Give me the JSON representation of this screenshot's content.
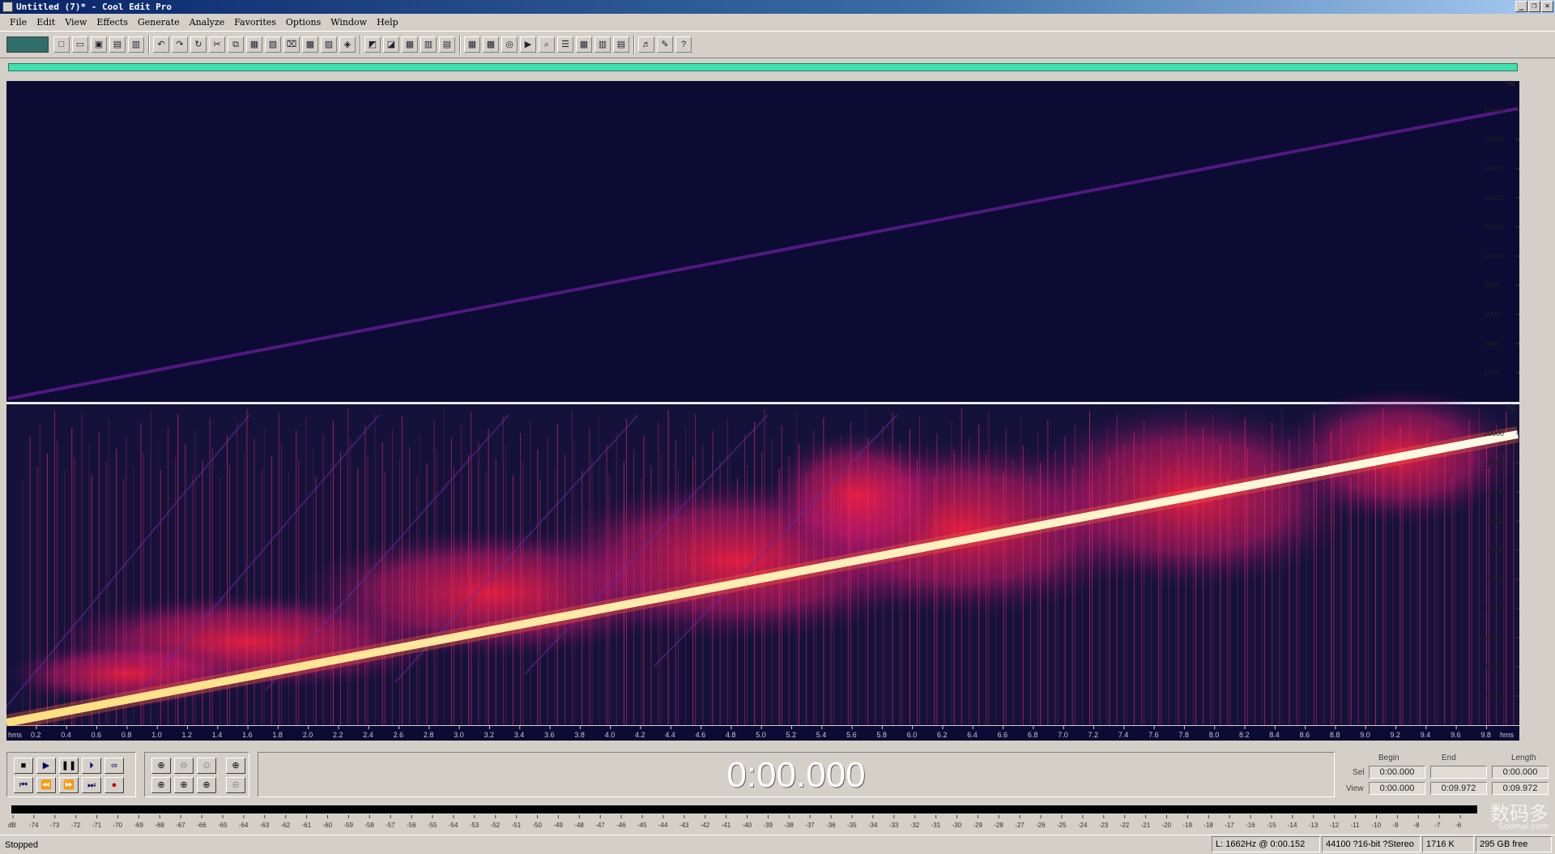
{
  "window": {
    "title": "Untitled (7)* - Cool Edit Pro",
    "controls": [
      "_",
      "❐",
      "✕"
    ]
  },
  "menu": [
    "File",
    "Edit",
    "View",
    "Effects",
    "Generate",
    "Analyze",
    "Favorites",
    "Options",
    "Window",
    "Help"
  ],
  "freq_axis": {
    "unit": "Hz",
    "ticks": [
      "20000",
      "18000",
      "16000",
      "14000",
      "12000",
      "10000",
      "8000",
      "6000",
      "4000",
      "2000"
    ]
  },
  "time_axis": {
    "start_label": "hms",
    "end_label": "hms",
    "ticks": [
      "0.2",
      "0.4",
      "0.6",
      "0.8",
      "1.0",
      "1.2",
      "1.4",
      "1.6",
      "1.8",
      "2.0",
      "2.2",
      "2.4",
      "2.6",
      "2.8",
      "3.0",
      "3.2",
      "3.4",
      "3.6",
      "3.8",
      "4.0",
      "4.2",
      "4.4",
      "4.6",
      "4.8",
      "5.0",
      "5.2",
      "5.4",
      "5.6",
      "5.8",
      "6.0",
      "6.2",
      "6.4",
      "6.6",
      "6.8",
      "7.0",
      "7.2",
      "7.4",
      "7.6",
      "7.8",
      "8.0",
      "8.2",
      "8.4",
      "8.6",
      "8.8",
      "9.0",
      "9.2",
      "9.4",
      "9.6",
      "9.8"
    ]
  },
  "transport": {
    "time": "0:00.000"
  },
  "selection": {
    "headers": {
      "begin": "Begin",
      "end": "End",
      "length": "Length"
    },
    "sel_label": "Sel",
    "view_label": "View",
    "sel_begin": "0:00.000",
    "sel_end": "",
    "sel_length": "0:00.000",
    "view_begin": "0:00.000",
    "view_end": "0:09.972",
    "view_length": "0:09.972"
  },
  "level_meter": {
    "labels": [
      "dB",
      "-74",
      "-73",
      "-72",
      "-71",
      "-70",
      "-69",
      "-68",
      "-67",
      "-66",
      "-65",
      "-64",
      "-63",
      "-62",
      "-61",
      "-60",
      "-59",
      "-58",
      "-57",
      "-56",
      "-55",
      "-54",
      "-53",
      "-52",
      "-51",
      "-50",
      "-49",
      "-48",
      "-47",
      "-46",
      "-45",
      "-44",
      "-43",
      "-42",
      "-41",
      "-40",
      "-39",
      "-38",
      "-37",
      "-36",
      "-35",
      "-34",
      "-33",
      "-32",
      "-31",
      "-30",
      "-29",
      "-28",
      "-27",
      "-26",
      "-25",
      "-24",
      "-23",
      "-22",
      "-21",
      "-20",
      "-19",
      "-18",
      "-17",
      "-16",
      "-15",
      "-14",
      "-13",
      "-12",
      "-11",
      "-10",
      "-9",
      "-8",
      "-7",
      "-6"
    ]
  },
  "status": {
    "state": "Stopped",
    "cursor": "L: 1662Hz @   0:00.152",
    "format": "44100 ?16-bit ?Stereo",
    "size": "1716 K",
    "free": "295 GB free"
  },
  "watermark": {
    "text": "数码多",
    "sub": "Soomal.com"
  },
  "colors": {
    "spectrum_bg": "#0a0a30",
    "sweep": "#fff8d0",
    "hot": "#ff2030",
    "accent": "#40e0b0"
  }
}
